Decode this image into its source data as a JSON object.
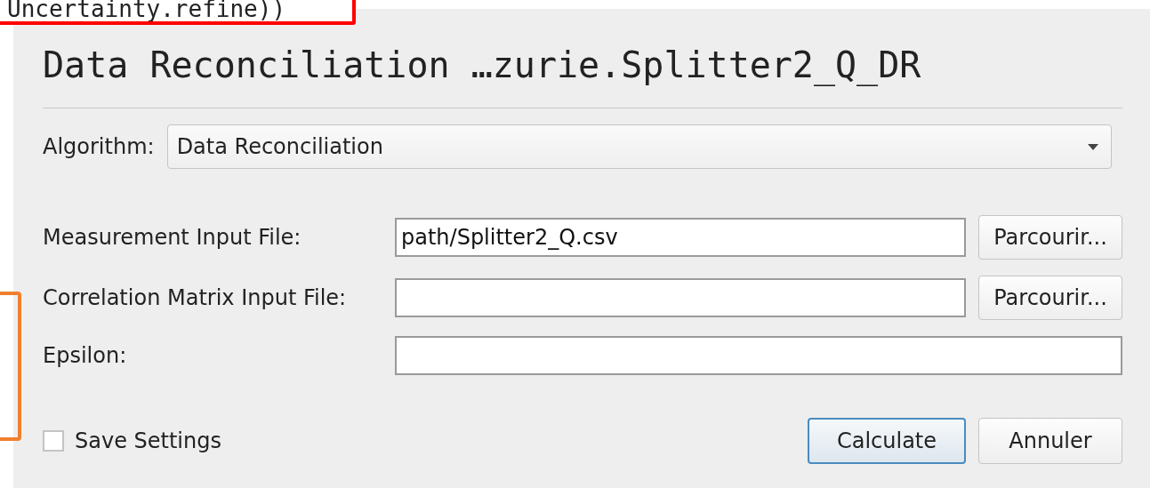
{
  "code_snippet": "Uncertainty.refine))",
  "dialog": {
    "title": "Data Reconciliation …zurie.Splitter2_Q_DR",
    "algorithm": {
      "label": "Algorithm:",
      "value": "Data Reconciliation"
    },
    "fields": [
      {
        "label": "Measurement Input File:",
        "value": "path/Splitter2_Q.csv",
        "button": "Parcourir..."
      },
      {
        "label": "Correlation Matrix Input File:",
        "button": "Parcourir..."
      },
      {
        "label": "Epsilon:"
      }
    ],
    "save_settings": {
      "label": "Save Settings",
      "checked": false
    },
    "buttons": [
      {
        "label": "Calculate",
        "default": true
      },
      {
        "label": "Annuler",
        "default": false
      }
    ]
  }
}
